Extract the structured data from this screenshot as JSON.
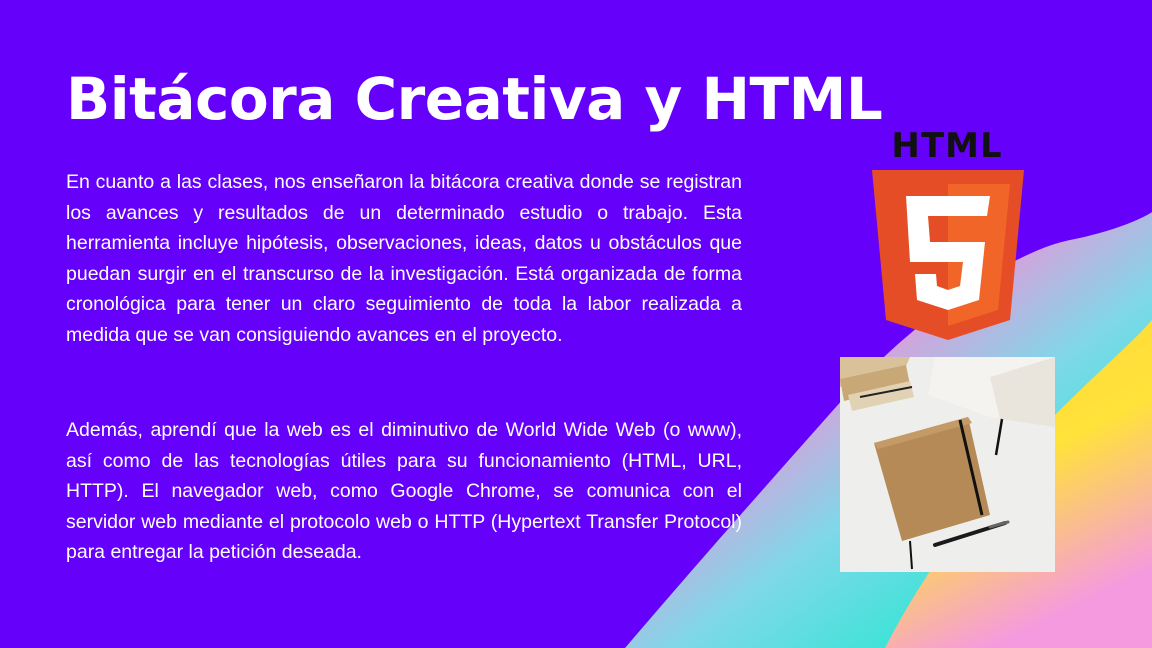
{
  "title": "Bitácora Creativa y HTML",
  "paragraphs": [
    "En cuanto a las clases, nos enseñaron la bitácora creativa donde se registran los avances y resultados de un determinado estudio o trabajo. Esta herramienta incluye hipótesis, observaciones, ideas, datos u obstáculos que puedan surgir en el transcurso de la investigación. Está organizada de forma cronológica para tener un claro seguimiento de toda la labor realizada a medida que se van consiguiendo avances en el proyecto.",
    "Además, aprendí que la web es el diminutivo de World Wide Web (o www), así como de las tecnologías útiles para su funcionamiento (HTML, URL, HTTP). El navegador web, como Google Chrome, se comunica con el servidor web mediante el protocolo web o HTTP (Hypertext Transfer Protocol) para entregar la petición deseada."
  ],
  "logo": {
    "word": "HTML",
    "digit": "5",
    "icon": "html5-logo-icon"
  },
  "photo": {
    "icon": "notebook-photo"
  },
  "colors": {
    "background": "#6500fb",
    "text": "#ffffff",
    "html5_dark": "#e44d26",
    "html5_light": "#f16529",
    "wave_pink": "#f58ed8",
    "wave_cyan": "#3fe3d8",
    "wave_yellow": "#ffe23a"
  }
}
